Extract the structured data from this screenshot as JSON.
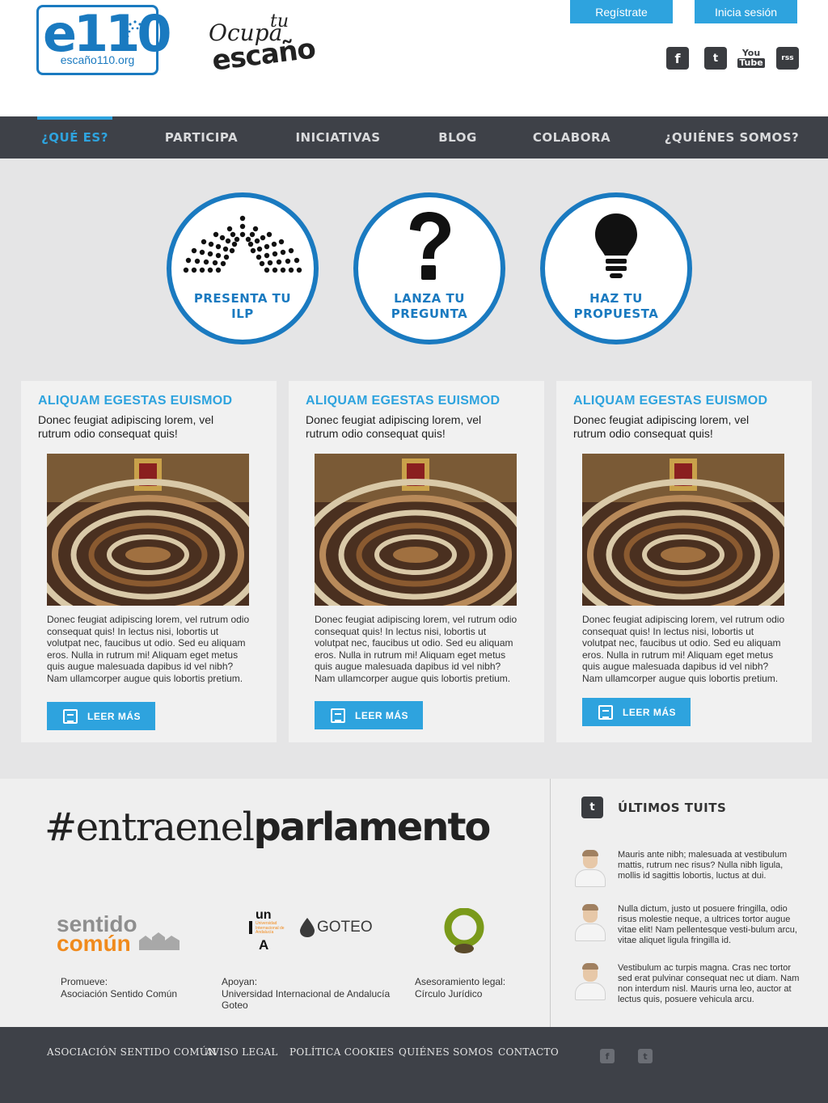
{
  "header": {
    "logo_big": "e110",
    "logo_url": "escaño110.org",
    "ocupa_l1": "Ocupa",
    "ocupa_l2": "tu",
    "ocupa_l3": "escaño",
    "register_label": "Regístrate",
    "login_label": "Inicia sesión",
    "social": {
      "facebook": "f",
      "twitter": "t",
      "youtube_top": "You",
      "youtube_bottom": "Tube",
      "rss": "rss"
    }
  },
  "nav": {
    "items": [
      {
        "label": "¿QUÉ ES?",
        "active": true
      },
      {
        "label": "PARTICIPA"
      },
      {
        "label": "INICIATIVAS"
      },
      {
        "label": "BLOG"
      },
      {
        "label": "COLABORA"
      },
      {
        "label": "¿QUIÉNES SOMOS?"
      }
    ]
  },
  "features": [
    {
      "label_1": "PRESENTA TU",
      "label_2": "ILP",
      "icon": "parliament-icon"
    },
    {
      "label_1": "LANZA TU",
      "label_2": "PREGUNTA",
      "icon": "question-mark-icon"
    },
    {
      "label_1": "HAZ TU",
      "label_2": "PROPUESTA",
      "icon": "lightbulb-icon"
    }
  ],
  "cards": [
    {
      "title": "ALIQUAM EGESTAS EUISMOD",
      "lead": "Donec feugiat adipiscing lorem, vel rutrum odio consequat quis!",
      "body": "Donec feugiat adipiscing lorem, vel rutrum odio consequat quis! In lectus nisi, lobortis ut volutpat nec, faucibus ut odio. Sed eu aliquam eros. Nulla in rutrum mi! Aliquam eget metus quis augue malesuada dapibus id vel nibh? Nam ullamcorper augue quis lobortis pretium.",
      "button": "LEER MÁS"
    },
    {
      "title": "ALIQUAM EGESTAS EUISMOD",
      "lead": "Donec feugiat adipiscing lorem, vel rutrum odio consequat quis!",
      "body": "Donec feugiat adipiscing lorem, vel rutrum odio consequat quis! In lectus nisi, lobortis ut volutpat nec, faucibus ut odio. Sed eu aliquam eros. Nulla in rutrum mi! Aliquam eget metus quis augue malesuada dapibus id vel nibh? Nam ullamcorper augue quis lobortis pretium.",
      "button": "LEER MÁS"
    },
    {
      "title": "ALIQUAM EGESTAS EUISMOD",
      "lead": "Donec feugiat adipiscing lorem, vel rutrum odio consequat quis!",
      "body": "Donec feugiat adipiscing lorem, vel rutrum odio consequat quis! In lectus nisi, lobortis ut volutpat nec, faucibus ut odio. Sed eu aliquam eros. Nulla in rutrum mi! Aliquam eget metus quis augue malesuada dapibus id vel nibh? Nam ullamcorper augue quis lobortis pretium.",
      "button": "LEER MÁS"
    }
  ],
  "campaign": {
    "hashtag_light": "#entraenel",
    "hashtag_bold": "parlamento"
  },
  "partners": {
    "sentido_1": "sentido",
    "sentido_2": "común",
    "unia_1": "un",
    "unia_small": "Universidad Internacional de Andalucía",
    "unia_2": "A",
    "goteo": "GOTEO"
  },
  "credits": {
    "promueve_label": "Promueve:",
    "promueve_value": "Asociación Sentido Común",
    "apoyan_label": "Apoyan:",
    "apoyan_value_1": "Universidad Internacional de Andalucía",
    "apoyan_value_2": "Goteo",
    "legal_label": "Asesoramiento legal:",
    "legal_value": "Círculo Jurídico"
  },
  "tweets": {
    "title": "ÚLTIMOS TUITS",
    "items": [
      "Mauris ante nibh; malesuada at vestibulum mattis, rutrum nec risus? Nulla nibh ligula, mollis id sagittis lobortis, luctus at dui.",
      "Nulla dictum, justo ut posuere fringilla, odio risus molestie neque, a ultrices tortor augue vitae elit! Nam pellentesque vesti-bulum arcu, vitae aliquet ligula fringilla id.",
      "Vestibulum ac turpis magna. Cras nec tortor sed erat pulvinar consequat nec ut diam. Nam non interdum nisl. Mauris urna leo, auctor at lectus quis, posuere vehicula arcu."
    ]
  },
  "footer": {
    "links": [
      "ASOCIACIÓN SENTIDO COMÚN",
      "AVISO LEGAL",
      "POLÍTICA COOKIES",
      "QUIÉNES SOMOS",
      "CONTACTO"
    ],
    "social": {
      "facebook": "f",
      "twitter": "t"
    }
  },
  "colors": {
    "accent": "#2ea3de",
    "brand_blue": "#1a7ac0",
    "nav_bg": "#3e4148",
    "main_bg": "#e5e5e6"
  }
}
